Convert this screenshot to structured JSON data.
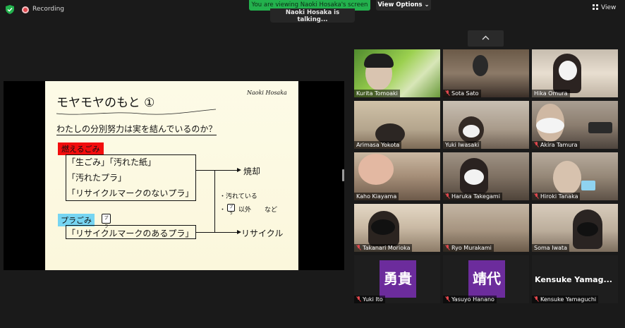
{
  "top": {
    "recording_label": "Recording",
    "banner": "You are viewing Naoki Hosaka's screen",
    "view_options": "View Options",
    "talking": "Naoki Hosaka is talking...",
    "view": "View"
  },
  "slide": {
    "title": "モヤモヤのもと ①",
    "author": "Naoki Hosaka",
    "subtitle": "わたしの分別努力は実を結んでいるのか？",
    "tag_burnable": "燃えるごみ",
    "line1": "「生ごみ」「汚れた紙」",
    "line2": "「汚れたプラ」",
    "line3": "「リサイクルマークのないプラ」",
    "out1": "焼却",
    "note1": "・汚れている",
    "note2": "以外",
    "note3": "など",
    "tag_plastic": "プラごみ",
    "pla_mark": "プラ",
    "line4": "「リサイクルマークのあるプラ」",
    "out2": "リサイクル"
  },
  "participants": [
    {
      "name": "Kurita Tomoaki",
      "muted": false
    },
    {
      "name": "Sota Sato",
      "muted": true
    },
    {
      "name": "Hika Omura",
      "muted": false
    },
    {
      "name": "Arimasa Yokota",
      "muted": false
    },
    {
      "name": "Yuki Iwasaki",
      "muted": false
    },
    {
      "name": "Akira Tamura",
      "muted": true
    },
    {
      "name": "Kaho Kiayama",
      "muted": false
    },
    {
      "name": "Haruka Takegami",
      "muted": true
    },
    {
      "name": "Hiroki Tanaka",
      "muted": true
    },
    {
      "name": "Takanari Morioka",
      "muted": true
    },
    {
      "name": "Ryo Murakami",
      "muted": true
    },
    {
      "name": "Soma Iwata",
      "muted": false
    },
    {
      "name": "Yuki Ito",
      "muted": true,
      "avatar": "勇貴"
    },
    {
      "name": "Yasuyo Hanano",
      "muted": true,
      "avatar": "靖代"
    },
    {
      "name": "Kensuke Yamaguchi",
      "muted": true,
      "avatar_text": "Kensuke  Yamag..."
    }
  ],
  "colors": {
    "banner": "#23b14d",
    "avatar": "#6c2c9c",
    "mute": "#e0474d"
  }
}
